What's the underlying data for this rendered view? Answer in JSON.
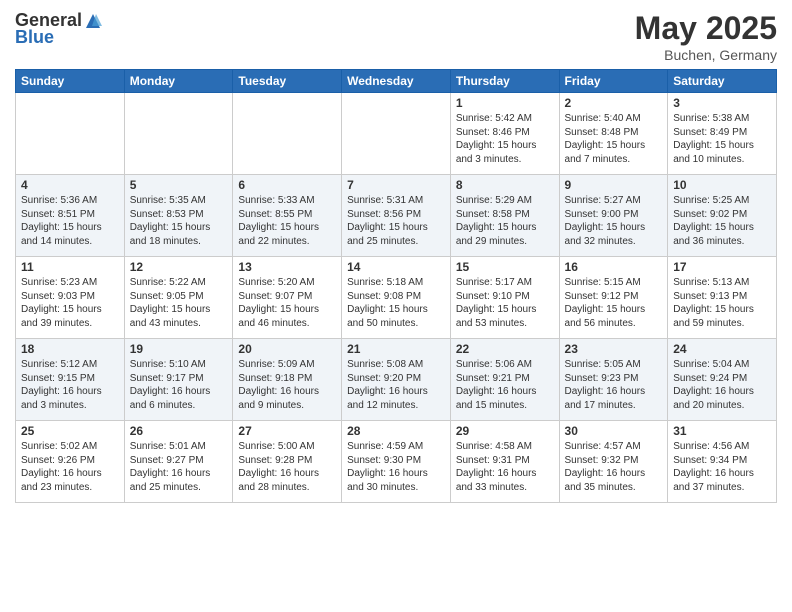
{
  "header": {
    "logo_general": "General",
    "logo_blue": "Blue",
    "month_title": "May 2025",
    "location": "Buchen, Germany"
  },
  "days_of_week": [
    "Sunday",
    "Monday",
    "Tuesday",
    "Wednesday",
    "Thursday",
    "Friday",
    "Saturday"
  ],
  "weeks": [
    {
      "days": [
        {
          "num": "",
          "info": ""
        },
        {
          "num": "",
          "info": ""
        },
        {
          "num": "",
          "info": ""
        },
        {
          "num": "",
          "info": ""
        },
        {
          "num": "1",
          "info": "Sunrise: 5:42 AM\nSunset: 8:46 PM\nDaylight: 15 hours\nand 3 minutes."
        },
        {
          "num": "2",
          "info": "Sunrise: 5:40 AM\nSunset: 8:48 PM\nDaylight: 15 hours\nand 7 minutes."
        },
        {
          "num": "3",
          "info": "Sunrise: 5:38 AM\nSunset: 8:49 PM\nDaylight: 15 hours\nand 10 minutes."
        }
      ]
    },
    {
      "days": [
        {
          "num": "4",
          "info": "Sunrise: 5:36 AM\nSunset: 8:51 PM\nDaylight: 15 hours\nand 14 minutes."
        },
        {
          "num": "5",
          "info": "Sunrise: 5:35 AM\nSunset: 8:53 PM\nDaylight: 15 hours\nand 18 minutes."
        },
        {
          "num": "6",
          "info": "Sunrise: 5:33 AM\nSunset: 8:55 PM\nDaylight: 15 hours\nand 22 minutes."
        },
        {
          "num": "7",
          "info": "Sunrise: 5:31 AM\nSunset: 8:56 PM\nDaylight: 15 hours\nand 25 minutes."
        },
        {
          "num": "8",
          "info": "Sunrise: 5:29 AM\nSunset: 8:58 PM\nDaylight: 15 hours\nand 29 minutes."
        },
        {
          "num": "9",
          "info": "Sunrise: 5:27 AM\nSunset: 9:00 PM\nDaylight: 15 hours\nand 32 minutes."
        },
        {
          "num": "10",
          "info": "Sunrise: 5:25 AM\nSunset: 9:02 PM\nDaylight: 15 hours\nand 36 minutes."
        }
      ]
    },
    {
      "days": [
        {
          "num": "11",
          "info": "Sunrise: 5:23 AM\nSunset: 9:03 PM\nDaylight: 15 hours\nand 39 minutes."
        },
        {
          "num": "12",
          "info": "Sunrise: 5:22 AM\nSunset: 9:05 PM\nDaylight: 15 hours\nand 43 minutes."
        },
        {
          "num": "13",
          "info": "Sunrise: 5:20 AM\nSunset: 9:07 PM\nDaylight: 15 hours\nand 46 minutes."
        },
        {
          "num": "14",
          "info": "Sunrise: 5:18 AM\nSunset: 9:08 PM\nDaylight: 15 hours\nand 50 minutes."
        },
        {
          "num": "15",
          "info": "Sunrise: 5:17 AM\nSunset: 9:10 PM\nDaylight: 15 hours\nand 53 minutes."
        },
        {
          "num": "16",
          "info": "Sunrise: 5:15 AM\nSunset: 9:12 PM\nDaylight: 15 hours\nand 56 minutes."
        },
        {
          "num": "17",
          "info": "Sunrise: 5:13 AM\nSunset: 9:13 PM\nDaylight: 15 hours\nand 59 minutes."
        }
      ]
    },
    {
      "days": [
        {
          "num": "18",
          "info": "Sunrise: 5:12 AM\nSunset: 9:15 PM\nDaylight: 16 hours\nand 3 minutes."
        },
        {
          "num": "19",
          "info": "Sunrise: 5:10 AM\nSunset: 9:17 PM\nDaylight: 16 hours\nand 6 minutes."
        },
        {
          "num": "20",
          "info": "Sunrise: 5:09 AM\nSunset: 9:18 PM\nDaylight: 16 hours\nand 9 minutes."
        },
        {
          "num": "21",
          "info": "Sunrise: 5:08 AM\nSunset: 9:20 PM\nDaylight: 16 hours\nand 12 minutes."
        },
        {
          "num": "22",
          "info": "Sunrise: 5:06 AM\nSunset: 9:21 PM\nDaylight: 16 hours\nand 15 minutes."
        },
        {
          "num": "23",
          "info": "Sunrise: 5:05 AM\nSunset: 9:23 PM\nDaylight: 16 hours\nand 17 minutes."
        },
        {
          "num": "24",
          "info": "Sunrise: 5:04 AM\nSunset: 9:24 PM\nDaylight: 16 hours\nand 20 minutes."
        }
      ]
    },
    {
      "days": [
        {
          "num": "25",
          "info": "Sunrise: 5:02 AM\nSunset: 9:26 PM\nDaylight: 16 hours\nand 23 minutes."
        },
        {
          "num": "26",
          "info": "Sunrise: 5:01 AM\nSunset: 9:27 PM\nDaylight: 16 hours\nand 25 minutes."
        },
        {
          "num": "27",
          "info": "Sunrise: 5:00 AM\nSunset: 9:28 PM\nDaylight: 16 hours\nand 28 minutes."
        },
        {
          "num": "28",
          "info": "Sunrise: 4:59 AM\nSunset: 9:30 PM\nDaylight: 16 hours\nand 30 minutes."
        },
        {
          "num": "29",
          "info": "Sunrise: 4:58 AM\nSunset: 9:31 PM\nDaylight: 16 hours\nand 33 minutes."
        },
        {
          "num": "30",
          "info": "Sunrise: 4:57 AM\nSunset: 9:32 PM\nDaylight: 16 hours\nand 35 minutes."
        },
        {
          "num": "31",
          "info": "Sunrise: 4:56 AM\nSunset: 9:34 PM\nDaylight: 16 hours\nand 37 minutes."
        }
      ]
    }
  ]
}
